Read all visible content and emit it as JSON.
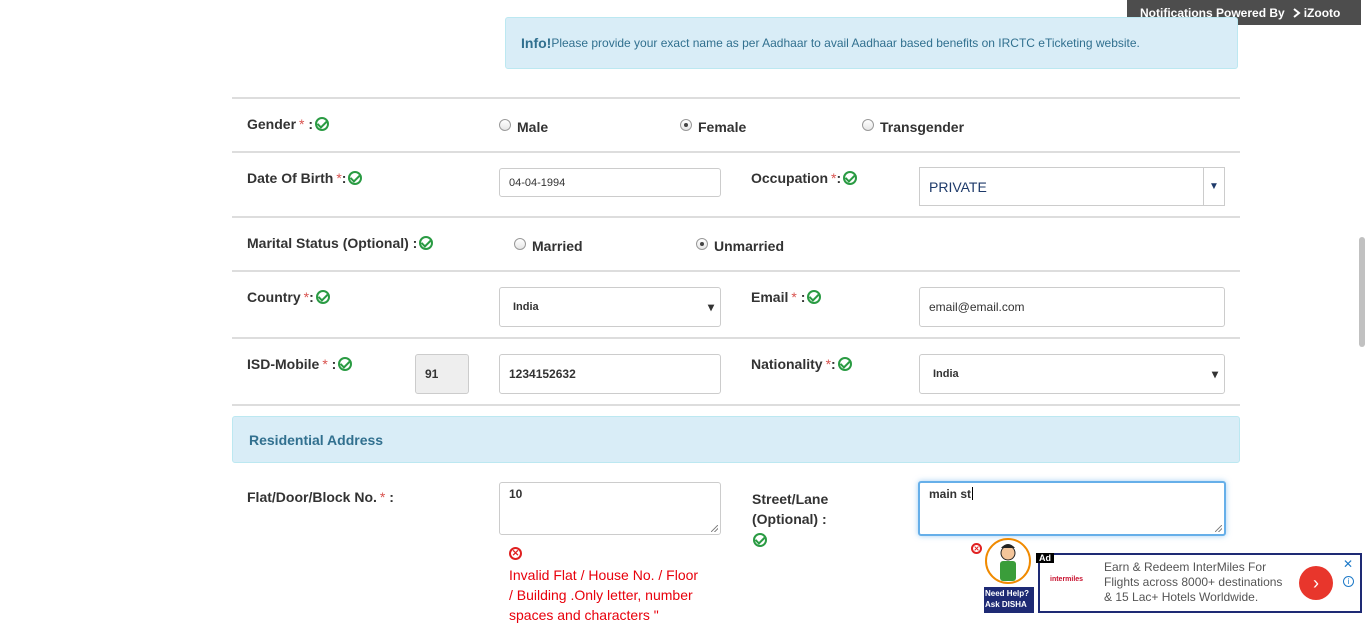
{
  "notification": {
    "text": "Notifications Powered By",
    "brand": "iZooto"
  },
  "info": {
    "title": "Info!",
    "message": "Please provide your exact name as per Aadhaar to avail Aadhaar based benefits on IRCTC eTicketing website."
  },
  "gender": {
    "label": "Gender",
    "options": [
      "Male",
      "Female",
      "Transgender"
    ],
    "selected": "Female"
  },
  "dob": {
    "label": "Date Of Birth",
    "value": "04-04-1994"
  },
  "occupation": {
    "label": "Occupation",
    "value": "PRIVATE"
  },
  "marital": {
    "label": "Marital Status (Optional) :",
    "options": [
      "Married",
      "Unmarried"
    ],
    "selected": "Unmarried"
  },
  "country": {
    "label": "Country",
    "value": "India"
  },
  "email": {
    "label": "Email",
    "value": "email@email.com"
  },
  "isd": {
    "label": "ISD-Mobile",
    "code": "91",
    "mobile": "1234152632"
  },
  "nationality": {
    "label": "Nationality",
    "value": "India"
  },
  "residential": {
    "heading": "Residential Address"
  },
  "flat": {
    "label": "Flat/Door/Block No.",
    "value": "10",
    "error_lines": [
      "Invalid Flat / House No. / Floor",
      "/ Building .Only letter, number",
      "spaces and characters \""
    ]
  },
  "street": {
    "label_line1": "Street/Lane",
    "label_line2": "(Optional) :",
    "value": "main st"
  },
  "ad": {
    "tag": "Ad",
    "logo": "intermiles",
    "lines": [
      "Earn & Redeem InterMiles For",
      "Flights across 8000+ destinations",
      "& 15 Lac+ Hotels Worldwide."
    ]
  },
  "disha": {
    "line1": "Need Help?",
    "line2": "Ask DISHA"
  }
}
